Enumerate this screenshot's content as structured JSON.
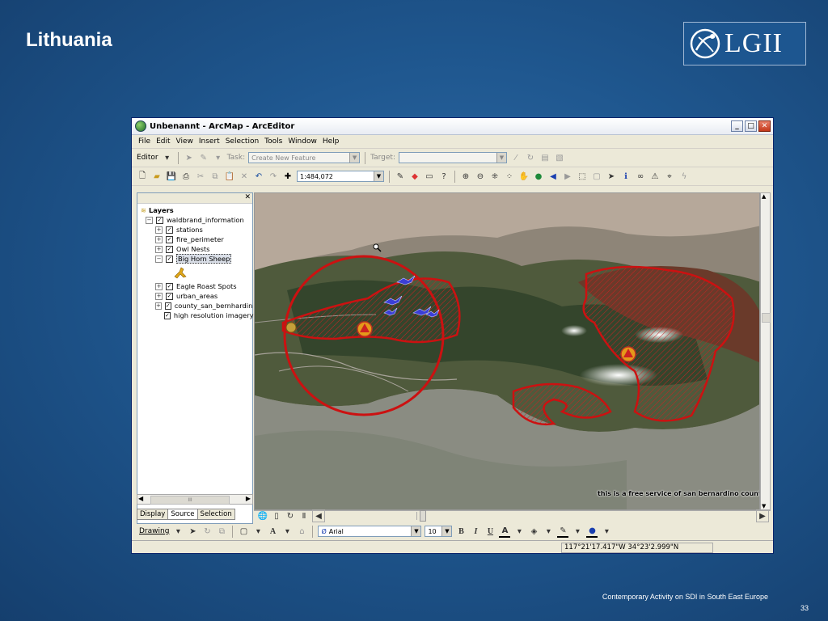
{
  "slide": {
    "title": "Lithuania",
    "logo_text": "LGII",
    "footer": "Contemporary Activity on SDI in South East Europe",
    "page_number": "33"
  },
  "window": {
    "title": "Unbenannt - ArcMap - ArcEditor",
    "menu": [
      "File",
      "Edit",
      "View",
      "Insert",
      "Selection",
      "Tools",
      "Window",
      "Help"
    ],
    "editor": {
      "label": "Editor",
      "task_label": "Task:",
      "task_value": "Create New Feature",
      "target_label": "Target:",
      "target_value": ""
    },
    "standard": {
      "scale": "1:484,072"
    },
    "toc": {
      "root": "Layers",
      "group": "waldbrand_information",
      "layers": [
        {
          "name": "stations",
          "checked": true
        },
        {
          "name": "fire_perimeter",
          "checked": true
        },
        {
          "name": "Owl Nests",
          "checked": true
        },
        {
          "name": "Big Horn Sheep",
          "checked": true,
          "selected": true
        },
        {
          "name": "Eagle Roast Spots",
          "checked": true
        },
        {
          "name": "urban_areas",
          "checked": true
        },
        {
          "name": "county_san_bernhardin",
          "checked": true
        },
        {
          "name": "high resolution imagery",
          "checked": true
        }
      ],
      "tabs": [
        "Display",
        "Source",
        "Selection"
      ],
      "active_tab": "Source",
      "scroll_mid": "III"
    },
    "map": {
      "credit": "this is a free service of san bernardino county"
    },
    "drawing": {
      "label": "Drawing",
      "font": "Arial",
      "size": "10",
      "bold": "B",
      "italic": "I",
      "underline": "U"
    },
    "status": {
      "coordinates": "117°21'17.417\"W  34°23'2.999\"N"
    }
  },
  "colors": {
    "slide_bg": "#1f578f",
    "fire_perimeter": "#cc1111",
    "titlebar": "#e8ecf3"
  }
}
